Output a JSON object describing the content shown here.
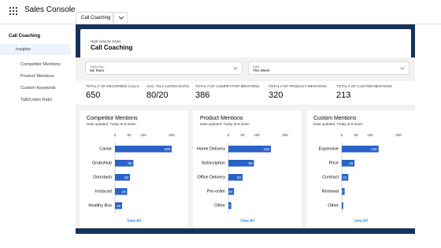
{
  "app": {
    "name": "Sales Console",
    "tab_label": "Call Coaching",
    "apps_icon": "app-launcher-grid",
    "tab_menu_icon": "chevron-down"
  },
  "sidebar": {
    "title": "Call Coaching",
    "items": [
      {
        "label": "Insights",
        "active": true
      },
      {
        "label": "Competitor Mentions",
        "active": false
      },
      {
        "label": "Product Mentions",
        "active": false
      },
      {
        "label": "Custom Keywords",
        "active": false
      },
      {
        "label": "Talk/Listen Ratio",
        "active": false
      }
    ]
  },
  "header": {
    "subtitle": "High Velocity Sales",
    "title": "Call Coaching"
  },
  "filters": [
    {
      "label": "Sales Rep",
      "value": "My Team"
    },
    {
      "label": "Date",
      "value": "This Week"
    }
  ],
  "stats": [
    {
      "label": "TOTAL # OF RECORDED CALLS",
      "value": "650"
    },
    {
      "label": "AVG. TALK:LISTEN RATIO",
      "value": "80/20"
    },
    {
      "label": "TOTAL # OF COMPETITOR MENTIONS",
      "value": "386"
    },
    {
      "label": "TOTAL # OF PRODUCT MENTIONS",
      "value": "320"
    },
    {
      "label": "TOTAL # OF CUSTOM MENTIONS",
      "value": "213"
    }
  ],
  "colors": {
    "bar": "#2a63c7",
    "band": "#16325c",
    "link": "#0070d2"
  },
  "chart_data": [
    {
      "type": "bar",
      "orientation": "horizontal",
      "title": "Competitor Mentions",
      "subtitle": "Data updated: Today at 8:32am",
      "categories": [
        "Caviar",
        "GrubsHub",
        "Doordash",
        "Instacart",
        "Healthy Box"
      ],
      "values": [
        200,
        65,
        53,
        43,
        25
      ],
      "ticks": [
        "0",
        "50",
        "100",
        "200"
      ],
      "tick_values": [
        0,
        50,
        100,
        200
      ],
      "xlim": [
        0,
        200
      ],
      "link": "View All"
    },
    {
      "type": "bar",
      "orientation": "horizontal",
      "title": "Product Mentions",
      "subtitle": "Data updated: Today at 8:32am",
      "categories": [
        "Home Delivery",
        "Subscription",
        "Office Delivery",
        "Pre-order",
        "Other"
      ],
      "values": [
        150,
        90,
        50,
        20,
        10
      ],
      "ticks": [
        "0",
        "50",
        "100",
        "200"
      ],
      "tick_values": [
        0,
        50,
        100,
        200
      ],
      "xlim": [
        0,
        200
      ],
      "link": "View All"
    },
    {
      "type": "bar",
      "orientation": "horizontal",
      "title": "Custom Mentions",
      "subtitle": "Data updated: Today at 8:32am",
      "categories": [
        "Expensive",
        "Price",
        "Contract",
        "Renewal",
        "Other"
      ],
      "values": [
        130,
        45,
        23,
        10,
        5
      ],
      "ticks": [
        "0",
        "50",
        "100",
        "200"
      ],
      "tick_values": [
        0,
        50,
        100,
        200
      ],
      "xlim": [
        0,
        200
      ],
      "link": "View All"
    }
  ]
}
